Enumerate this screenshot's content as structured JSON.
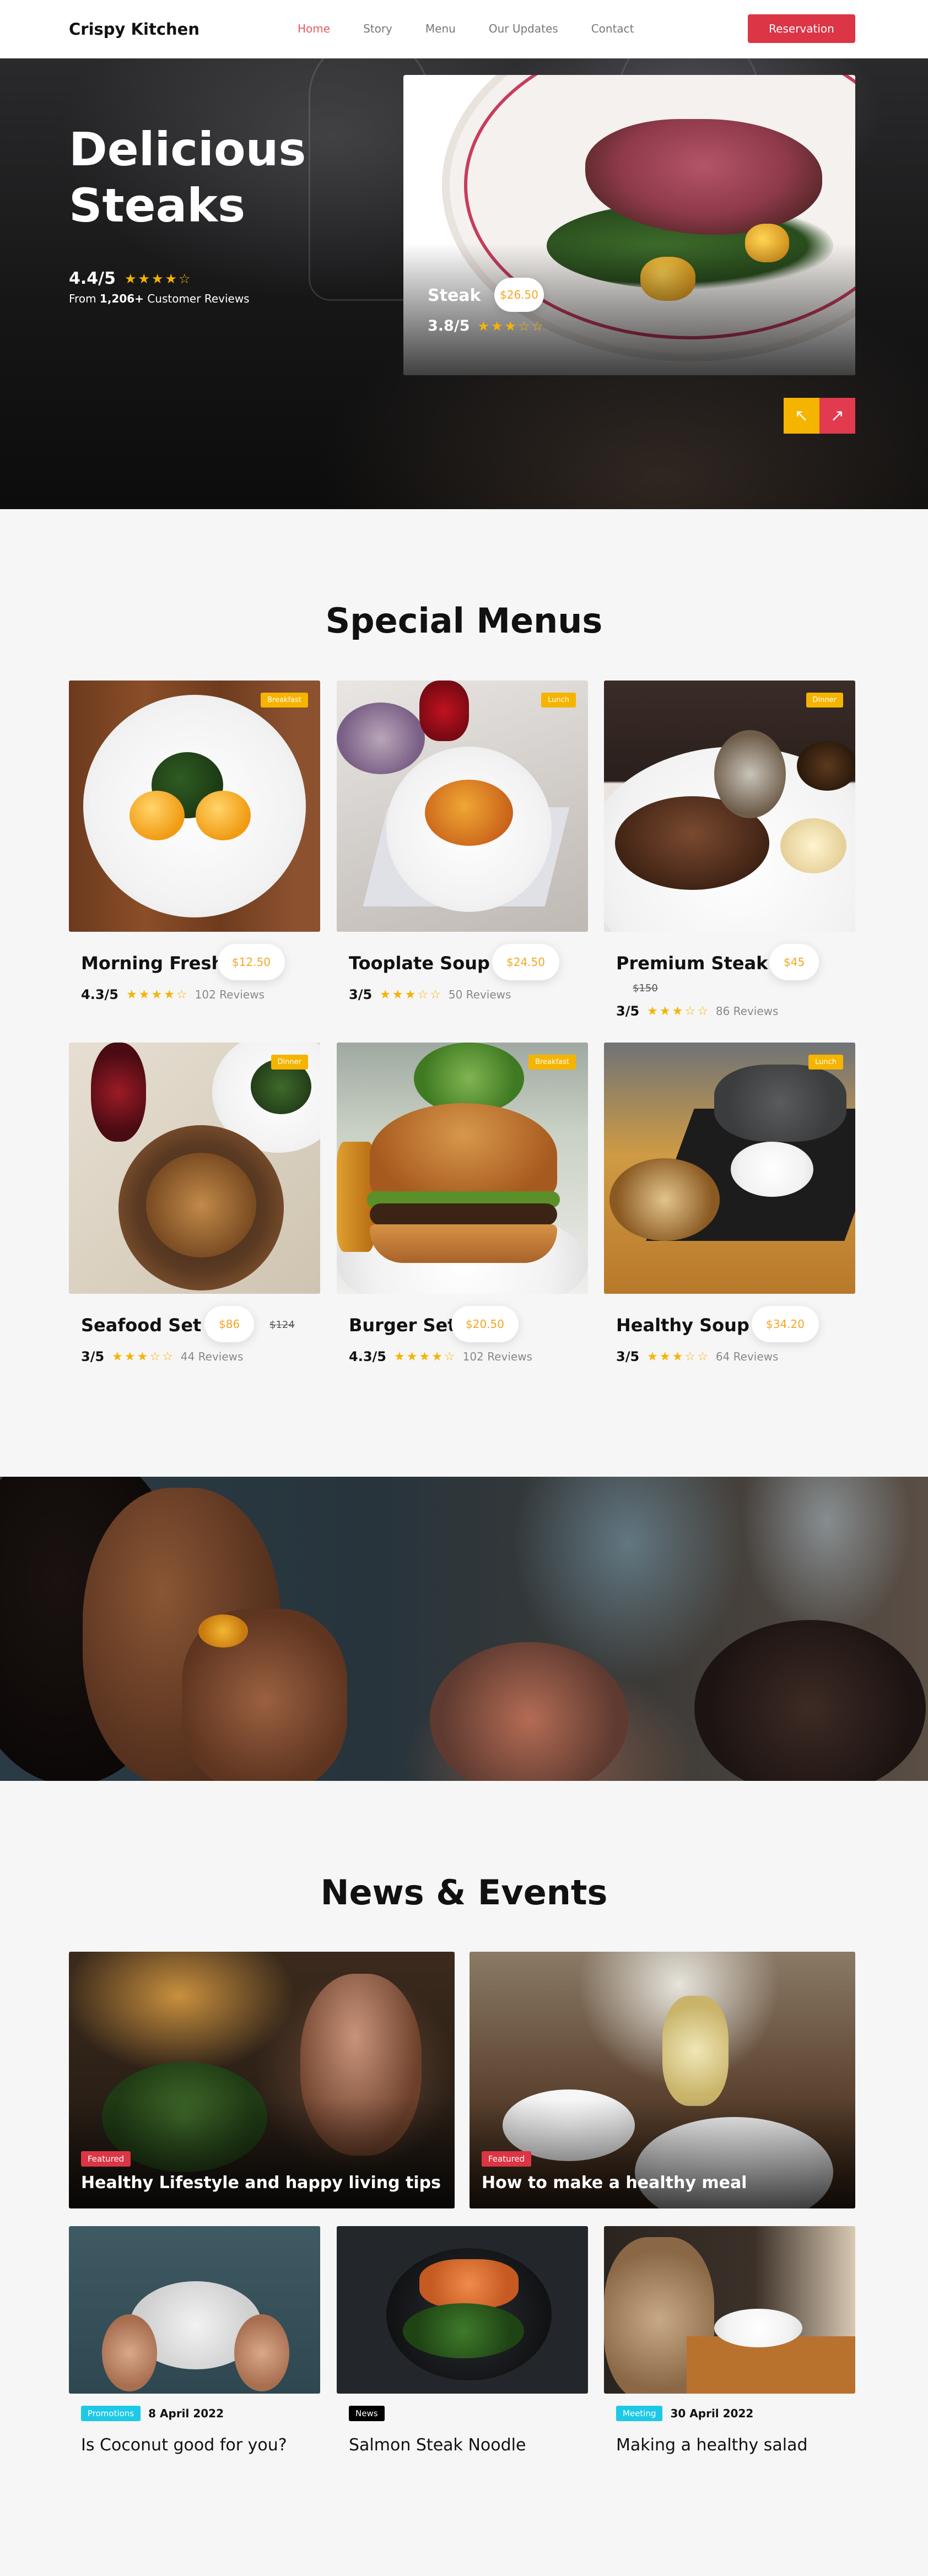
{
  "nav": {
    "brand": "Crispy Kitchen",
    "items": [
      "Home",
      "Story",
      "Menu",
      "Our Updates",
      "Contact"
    ],
    "active": "Home",
    "cta": "Reservation"
  },
  "hero": {
    "title": "Delicious Steaks",
    "rating": "4.4/5",
    "stars": 4,
    "reviews_prefix": "From ",
    "reviews_count": "1,206+",
    "reviews_suffix": " Customer Reviews",
    "featured": {
      "name": "Steak",
      "price": "$26.50",
      "rating": "3.8/5",
      "stars": 3
    },
    "prev_icon": "arrow-up-left-icon",
    "next_icon": "arrow-up-right-icon"
  },
  "special": {
    "title": "Special Menus",
    "items": [
      {
        "tag": "Breakfast",
        "name": "Morning Fresh",
        "price": "$12.50",
        "old_price": "",
        "rating": "4.3/5",
        "stars": 4,
        "reviews": "102 Reviews"
      },
      {
        "tag": "Lunch",
        "name": "Tooplate Soup",
        "price": "$24.50",
        "old_price": "",
        "rating": "3/5",
        "stars": 3,
        "reviews": "50 Reviews"
      },
      {
        "tag": "Dinner",
        "name": "Premium Steak",
        "price": "$45",
        "old_price": "$150",
        "rating": "3/5",
        "stars": 3,
        "reviews": "86 Reviews"
      },
      {
        "tag": "Dinner",
        "name": "Seafood Set",
        "price": "$86",
        "old_price": "$124",
        "rating": "3/5",
        "stars": 3,
        "reviews": "44 Reviews"
      },
      {
        "tag": "Breakfast",
        "name": "Burger Set",
        "price": "$20.50",
        "old_price": "",
        "rating": "4.3/5",
        "stars": 4,
        "reviews": "102 Reviews"
      },
      {
        "tag": "Lunch",
        "name": "Healthy Soup",
        "price": "$34.20",
        "old_price": "",
        "rating": "3/5",
        "stars": 3,
        "reviews": "64 Reviews"
      }
    ]
  },
  "news": {
    "title": "News & Events",
    "featured": [
      {
        "badge": "Featured",
        "title": "Healthy Lifestyle and happy living tips"
      },
      {
        "badge": "Featured",
        "title": "How to make a healthy meal"
      }
    ],
    "items": [
      {
        "badge": "Promotions",
        "badge_color": "#1ec8e6",
        "date": "8 April 2022",
        "title": "Is Coconut good for you?"
      },
      {
        "badge": "News",
        "badge_color": "#000000",
        "date": "",
        "title": "Salmon Steak Noodle"
      },
      {
        "badge": "Meeting",
        "badge_color": "#1ec8e6",
        "date": "30 April 2022",
        "title": "Making a healthy salad"
      }
    ]
  },
  "colors": {
    "accent": "#dc3545",
    "star": "#f5b400",
    "price": "#f5a623",
    "active_nav": "#e85b5b"
  }
}
